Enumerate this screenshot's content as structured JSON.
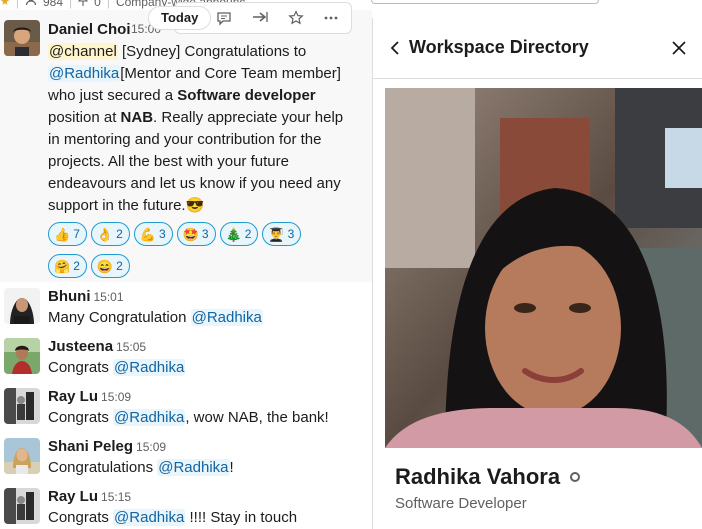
{
  "top_strip": {
    "member_count": "984",
    "reply_count": "0",
    "channel_description": "Company-wide announc"
  },
  "date_divider": {
    "label": "Today"
  },
  "message_actions": [
    {
      "icon": "emoji-add-icon"
    },
    {
      "icon": "reply-thread-icon"
    },
    {
      "icon": "share-icon"
    },
    {
      "icon": "star-icon"
    },
    {
      "icon": "more-actions-icon"
    }
  ],
  "main_message": {
    "author": "Daniel Choi",
    "time": "15:00",
    "channel_mention": "@channel",
    "location_tag": "[Sydney]",
    "text_1": " Congratulations to",
    "user_mention": "@Radhika",
    "role_tag": "[Mentor and Core Team member]",
    "line_3": "who just secured a ",
    "role_bold": "Software developer",
    "line_4a": "position at ",
    "company_bold": "NAB",
    "line_4b": ".  Really appreciate your help",
    "line_5": "in mentoring and your contribution for the",
    "line_6": "projects. All the best with your future",
    "line_7": "endeavours and let us know if you need any",
    "line_8": "support in the future.",
    "line_8_emoji": "😎"
  },
  "reactions": [
    {
      "emoji": "👍",
      "count": "7"
    },
    {
      "emoji": "👌",
      "count": "2"
    },
    {
      "emoji": "💪",
      "count": "3"
    },
    {
      "emoji": "🤩",
      "count": "3"
    },
    {
      "emoji": "🎄",
      "count": "2"
    },
    {
      "emoji": "👨‍🎓",
      "count": "3"
    },
    {
      "emoji": "🤗",
      "count": "2"
    },
    {
      "emoji": "😄",
      "count": "2"
    }
  ],
  "replies": [
    {
      "author": "Bhuni",
      "time": "15:01",
      "before": "Many Congratulation ",
      "mention": "@Radhika",
      "after": ""
    },
    {
      "author": "Justeena",
      "time": "15:05",
      "before": "Congrats ",
      "mention": "@Radhika",
      "after": ""
    },
    {
      "author": "Ray Lu",
      "time": "15:09",
      "before": "Congrats ",
      "mention": "@Radhika",
      "after": ", wow NAB, the bank!"
    },
    {
      "author": "Shani Peleg",
      "time": "15:09",
      "before": "Congratulations ",
      "mention": "@Radhika",
      "after": "!"
    },
    {
      "author": "Ray Lu",
      "time": "15:15",
      "before": "Congrats ",
      "mention": "@Radhika",
      "after": " !!!! Stay in touch"
    }
  ],
  "panel": {
    "title": "Workspace Directory",
    "profile_name": "Radhika Vahora",
    "profile_title": "Software Developer"
  },
  "colors": {
    "mention_text": "#1264a3",
    "mention_bg": "#e8f5fa",
    "reaction_border": "#1d9bd1",
    "channel_mention_bg": "#fff5cc"
  }
}
